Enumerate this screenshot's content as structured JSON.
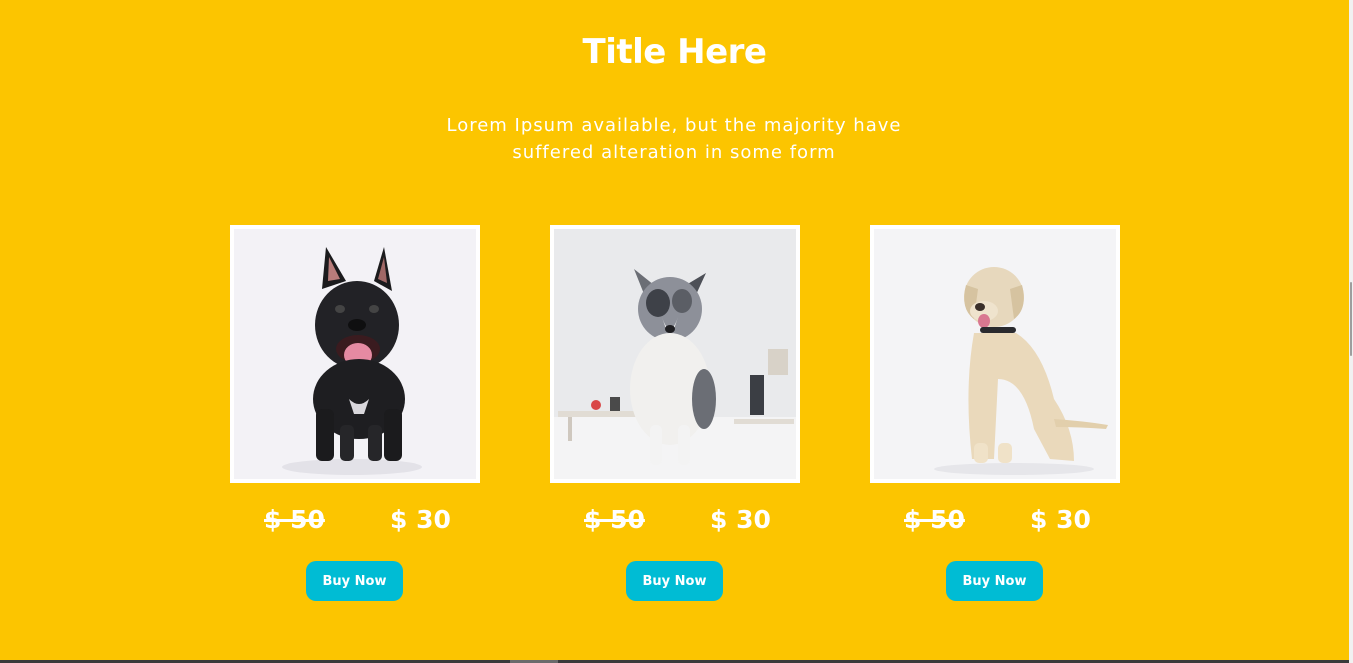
{
  "header": {
    "title": "Title Here",
    "subtitle": "Lorem Ipsum available, but the majority have suffered alteration in some form"
  },
  "products": [
    {
      "image_icon": "french-bulldog-photo",
      "old_price": "$ 50",
      "new_price": "$ 30",
      "buy_label": "Buy Now"
    },
    {
      "image_icon": "border-collie-puppy-photo",
      "old_price": "$ 50",
      "new_price": "$ 30",
      "buy_label": "Buy Now"
    },
    {
      "image_icon": "labrador-photo",
      "old_price": "$ 50",
      "new_price": "$ 30",
      "buy_label": "Buy Now"
    }
  ],
  "colors": {
    "background": "#fcc500",
    "button": "#00bcd4",
    "text": "#ffffff"
  }
}
